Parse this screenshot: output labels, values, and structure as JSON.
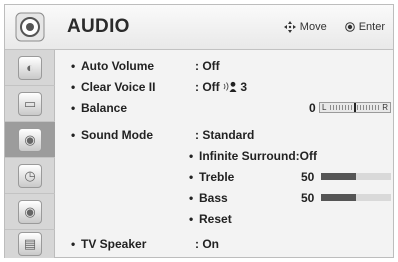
{
  "header": {
    "title": "AUDIO",
    "move_icon": "four-way-arrow",
    "move_label": "Move",
    "enter_icon": "ok-button",
    "enter_label": "Enter"
  },
  "sidebar": {
    "active_index": 3,
    "items": [
      {
        "icon": "picture-icon"
      },
      {
        "icon": "screen-icon"
      },
      {
        "icon": "audio-icon"
      },
      {
        "icon": "time-icon"
      },
      {
        "icon": "lock-icon"
      },
      {
        "icon": "option-icon"
      }
    ]
  },
  "settings": {
    "auto_volume": {
      "bullet": "•",
      "label": "Auto Volume",
      "value": ": Off"
    },
    "clear_voice": {
      "bullet": "•",
      "label": "Clear Voice II",
      "value": ": Off",
      "level": "3"
    },
    "balance": {
      "bullet": "•",
      "label": "Balance",
      "value": "0",
      "left": "L",
      "right": "R",
      "level": 0.5
    },
    "sound_mode": {
      "bullet": "•",
      "label": "Sound Mode",
      "value": ": Standard"
    },
    "infinite_surround": {
      "bullet": "•",
      "label": "Infinite Surround",
      "value": ":Off"
    },
    "treble": {
      "bullet": "•",
      "label": "Treble",
      "value": "50",
      "level": 0.5
    },
    "bass": {
      "bullet": "•",
      "label": "Bass",
      "value": "50",
      "level": 0.5
    },
    "reset": {
      "bullet": "•",
      "label": "Reset"
    },
    "tv_speaker": {
      "bullet": "•",
      "label": "TV Speaker",
      "value": ": On"
    }
  }
}
